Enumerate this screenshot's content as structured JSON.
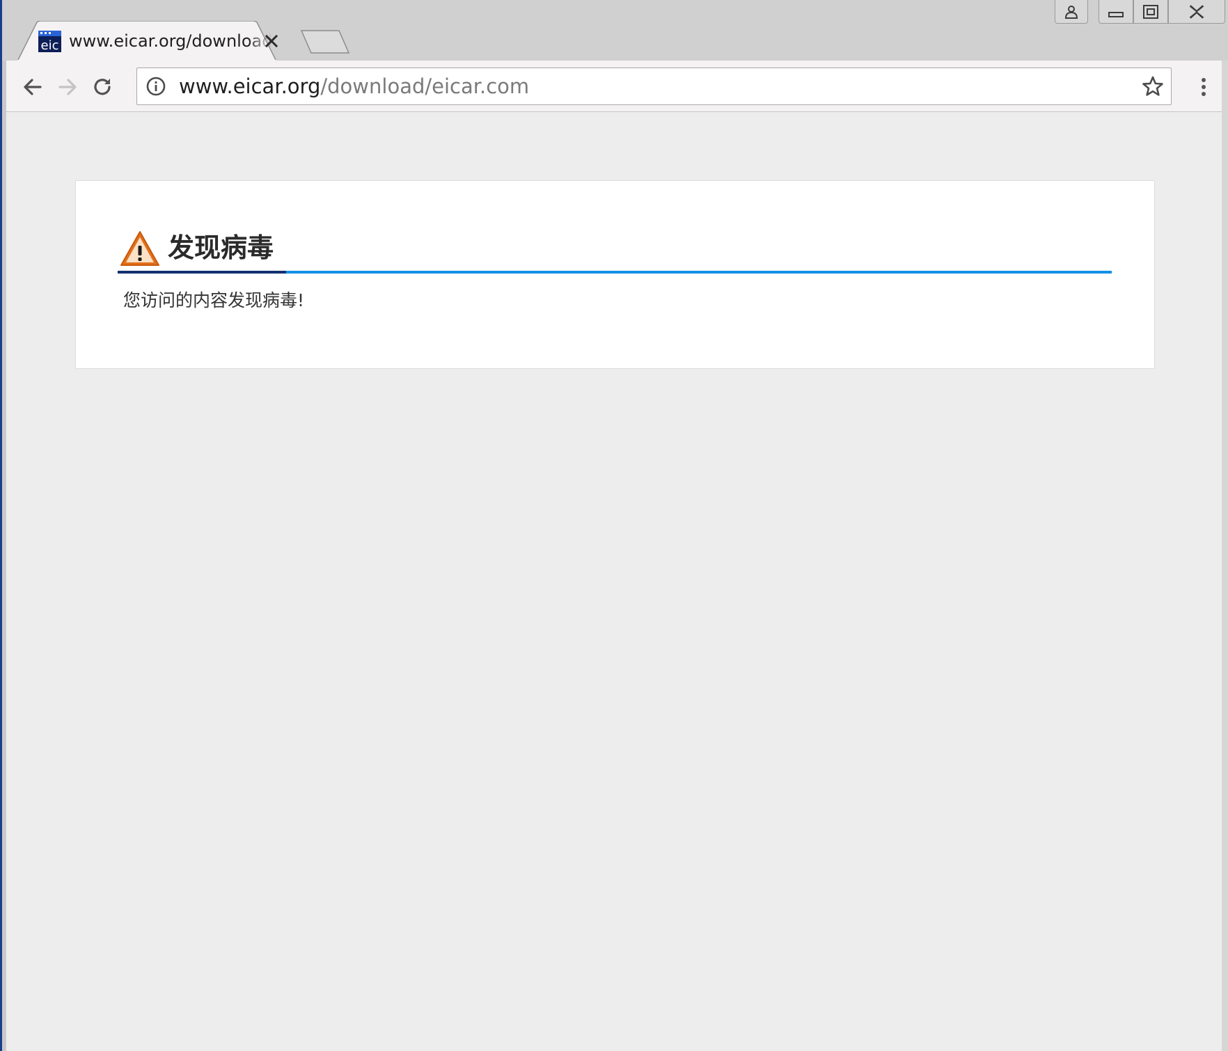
{
  "browser": {
    "tab": {
      "title": "www.eicar.org/download/eicar.com",
      "favicon_text": "eic"
    },
    "address_bar": {
      "host": "www.eicar.org",
      "path": "/download/eicar.com"
    },
    "caption_buttons": [
      "profile-icon",
      "minimize-icon",
      "restore-icon",
      "close-icon"
    ]
  },
  "page": {
    "card": {
      "title": "发现病毒",
      "message": "您访问的内容发现病毒!"
    }
  },
  "colors": {
    "rule_dark": "#14306e",
    "rule_blue": "#1590e8",
    "warning_orange": "#e2701a",
    "page_background": "#ededed"
  }
}
